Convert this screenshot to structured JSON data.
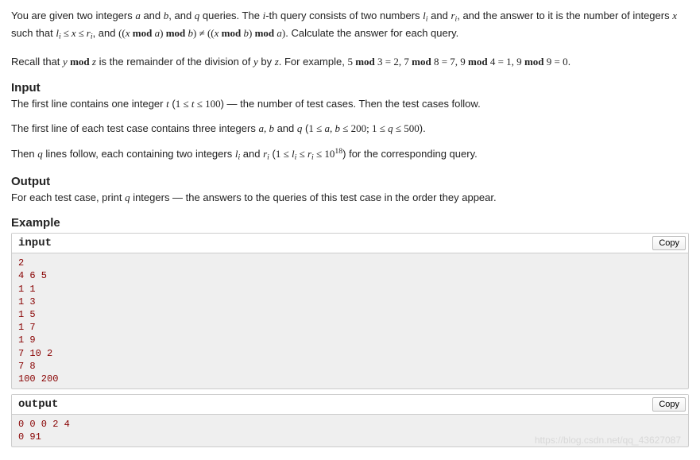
{
  "intro_p1_prefix": "You are given two integers ",
  "intro_a": "a",
  "intro_and1": " and ",
  "intro_b": "b",
  "intro_p1_mid1": ", and ",
  "intro_q": "q",
  "intro_p1_mid2": " queries. The ",
  "intro_i": "i",
  "intro_p1_mid3": "-th query consists of two numbers ",
  "intro_li_l": "l",
  "intro_li_i": "i",
  "intro_p1_mid4": " and ",
  "intro_ri_r": "r",
  "intro_ri_i": "i",
  "intro_p1_mid5": ", and the answer to it is the number of integers ",
  "intro_x": "x",
  "intro_p1_mid6": " such that ",
  "intro_cond1": "l",
  "intro_le": "≤",
  "intro_cond2": "x",
  "intro_cond3": "r",
  "intro_p1_mid7": ", and ",
  "intro_modexpr": "((x mod a) mod b) ≠ ((x mod b) mod a)",
  "intro_p1_end": ". Calculate the answer for each query.",
  "recall_prefix": "Recall that ",
  "recall_ymodz": "y mod z",
  "recall_mid1": " is the remainder of the division of ",
  "recall_y": "y",
  "recall_by": " by ",
  "recall_z": "z",
  "recall_mid2": ". For example, ",
  "recall_ex": "5 mod 3 = 2, 7 mod 8 = 7, 9 mod 4 = 1, 9 mod 9 = 0",
  "recall_end": ".",
  "input_title": "Input",
  "input_p1a": "The first line contains one integer ",
  "input_t": "t",
  "input_p1b": " (",
  "input_trange": "1 ≤ t ≤ 100",
  "input_p1c": ") — the number of test cases. Then the test cases follow.",
  "input_p2a": "The first line of each test case contains three integers ",
  "input_abq": "a, b",
  "input_p2a2": " and ",
  "input_q2": "q",
  "input_p2b": " (",
  "input_abrange": "1 ≤ a, b ≤ 200; 1 ≤ q ≤ 500",
  "input_p2c": ").",
  "input_p3a": "Then ",
  "input_p3b": " lines follow, each containing two integers ",
  "input_p3c": " and ",
  "input_p3d": " (",
  "input_lrange": "1 ≤ l",
  "input_lrange2": " ≤ r",
  "input_lrange3": " ≤ 10",
  "input_lexp": "18",
  "input_p3e": ") for the corresponding query.",
  "output_title": "Output",
  "output_p1a": "For each test case, print ",
  "output_p1b": " integers — the answers to the queries of this test case in the order they appear.",
  "example_title": "Example",
  "input_label": "input",
  "output_label": "output",
  "copy_label": "Copy",
  "sample_input": "2\n4 6 5\n1 1\n1 3\n1 5\n1 7\n1 9\n7 10 2\n7 8\n100 200",
  "sample_output": "0 0 0 2 4\n0 91",
  "watermark": "https://blog.csdn.net/qq_43627087"
}
